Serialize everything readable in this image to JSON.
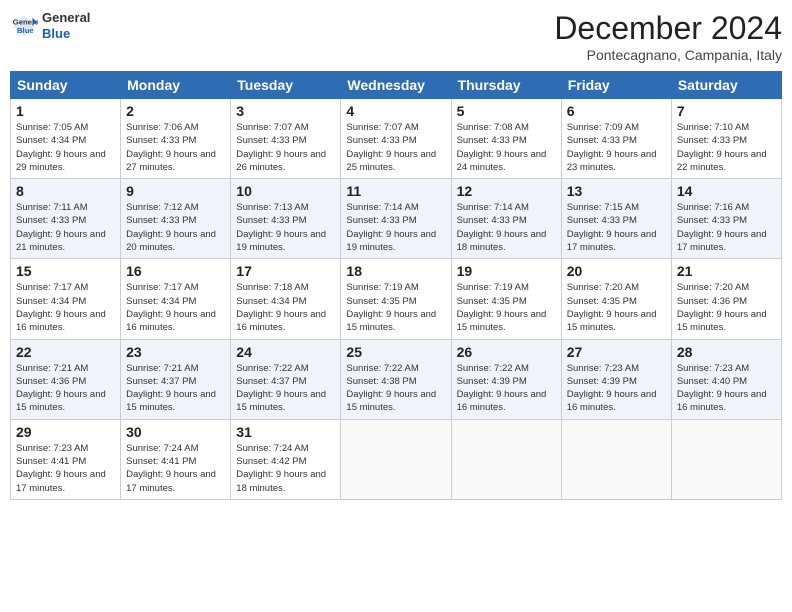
{
  "header": {
    "logo_general": "General",
    "logo_blue": "Blue",
    "month_title": "December 2024",
    "location": "Pontecagnano, Campania, Italy"
  },
  "days_of_week": [
    "Sunday",
    "Monday",
    "Tuesday",
    "Wednesday",
    "Thursday",
    "Friday",
    "Saturday"
  ],
  "weeks": [
    [
      {
        "day": "1",
        "sunrise": "7:05 AM",
        "sunset": "4:34 PM",
        "daylight": "9 hours and 29 minutes."
      },
      {
        "day": "2",
        "sunrise": "7:06 AM",
        "sunset": "4:33 PM",
        "daylight": "9 hours and 27 minutes."
      },
      {
        "day": "3",
        "sunrise": "7:07 AM",
        "sunset": "4:33 PM",
        "daylight": "9 hours and 26 minutes."
      },
      {
        "day": "4",
        "sunrise": "7:07 AM",
        "sunset": "4:33 PM",
        "daylight": "9 hours and 25 minutes."
      },
      {
        "day": "5",
        "sunrise": "7:08 AM",
        "sunset": "4:33 PM",
        "daylight": "9 hours and 24 minutes."
      },
      {
        "day": "6",
        "sunrise": "7:09 AM",
        "sunset": "4:33 PM",
        "daylight": "9 hours and 23 minutes."
      },
      {
        "day": "7",
        "sunrise": "7:10 AM",
        "sunset": "4:33 PM",
        "daylight": "9 hours and 22 minutes."
      }
    ],
    [
      {
        "day": "8",
        "sunrise": "7:11 AM",
        "sunset": "4:33 PM",
        "daylight": "9 hours and 21 minutes."
      },
      {
        "day": "9",
        "sunrise": "7:12 AM",
        "sunset": "4:33 PM",
        "daylight": "9 hours and 20 minutes."
      },
      {
        "day": "10",
        "sunrise": "7:13 AM",
        "sunset": "4:33 PM",
        "daylight": "9 hours and 19 minutes."
      },
      {
        "day": "11",
        "sunrise": "7:14 AM",
        "sunset": "4:33 PM",
        "daylight": "9 hours and 19 minutes."
      },
      {
        "day": "12",
        "sunrise": "7:14 AM",
        "sunset": "4:33 PM",
        "daylight": "9 hours and 18 minutes."
      },
      {
        "day": "13",
        "sunrise": "7:15 AM",
        "sunset": "4:33 PM",
        "daylight": "9 hours and 17 minutes."
      },
      {
        "day": "14",
        "sunrise": "7:16 AM",
        "sunset": "4:33 PM",
        "daylight": "9 hours and 17 minutes."
      }
    ],
    [
      {
        "day": "15",
        "sunrise": "7:17 AM",
        "sunset": "4:34 PM",
        "daylight": "9 hours and 16 minutes."
      },
      {
        "day": "16",
        "sunrise": "7:17 AM",
        "sunset": "4:34 PM",
        "daylight": "9 hours and 16 minutes."
      },
      {
        "day": "17",
        "sunrise": "7:18 AM",
        "sunset": "4:34 PM",
        "daylight": "9 hours and 16 minutes."
      },
      {
        "day": "18",
        "sunrise": "7:19 AM",
        "sunset": "4:35 PM",
        "daylight": "9 hours and 15 minutes."
      },
      {
        "day": "19",
        "sunrise": "7:19 AM",
        "sunset": "4:35 PM",
        "daylight": "9 hours and 15 minutes."
      },
      {
        "day": "20",
        "sunrise": "7:20 AM",
        "sunset": "4:35 PM",
        "daylight": "9 hours and 15 minutes."
      },
      {
        "day": "21",
        "sunrise": "7:20 AM",
        "sunset": "4:36 PM",
        "daylight": "9 hours and 15 minutes."
      }
    ],
    [
      {
        "day": "22",
        "sunrise": "7:21 AM",
        "sunset": "4:36 PM",
        "daylight": "9 hours and 15 minutes."
      },
      {
        "day": "23",
        "sunrise": "7:21 AM",
        "sunset": "4:37 PM",
        "daylight": "9 hours and 15 minutes."
      },
      {
        "day": "24",
        "sunrise": "7:22 AM",
        "sunset": "4:37 PM",
        "daylight": "9 hours and 15 minutes."
      },
      {
        "day": "25",
        "sunrise": "7:22 AM",
        "sunset": "4:38 PM",
        "daylight": "9 hours and 15 minutes."
      },
      {
        "day": "26",
        "sunrise": "7:22 AM",
        "sunset": "4:39 PM",
        "daylight": "9 hours and 16 minutes."
      },
      {
        "day": "27",
        "sunrise": "7:23 AM",
        "sunset": "4:39 PM",
        "daylight": "9 hours and 16 minutes."
      },
      {
        "day": "28",
        "sunrise": "7:23 AM",
        "sunset": "4:40 PM",
        "daylight": "9 hours and 16 minutes."
      }
    ],
    [
      {
        "day": "29",
        "sunrise": "7:23 AM",
        "sunset": "4:41 PM",
        "daylight": "9 hours and 17 minutes."
      },
      {
        "day": "30",
        "sunrise": "7:24 AM",
        "sunset": "4:41 PM",
        "daylight": "9 hours and 17 minutes."
      },
      {
        "day": "31",
        "sunrise": "7:24 AM",
        "sunset": "4:42 PM",
        "daylight": "9 hours and 18 minutes."
      },
      null,
      null,
      null,
      null
    ]
  ],
  "labels": {
    "sunrise": "Sunrise:",
    "sunset": "Sunset:",
    "daylight": "Daylight:"
  }
}
